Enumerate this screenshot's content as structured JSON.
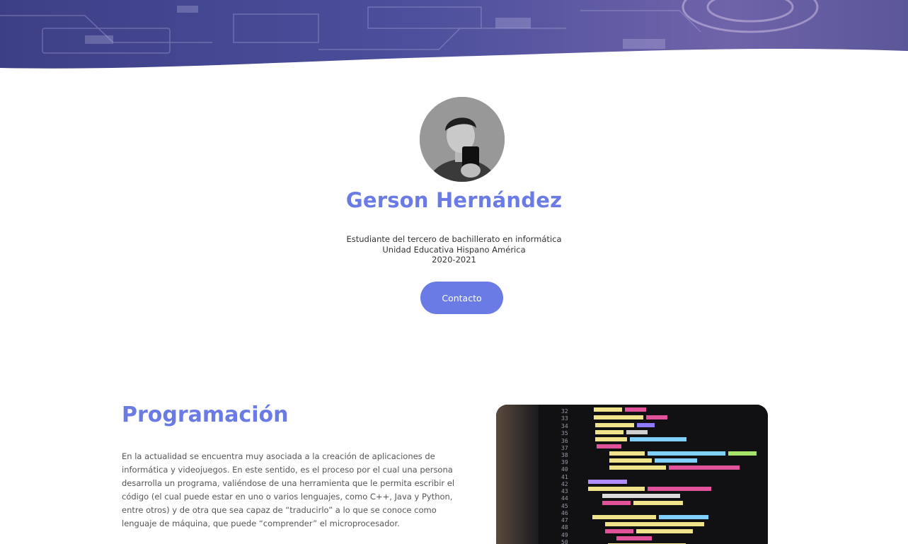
{
  "hero": {
    "image_icon": "circuit-board-image"
  },
  "profile": {
    "avatar_icon": "profile-photo",
    "name": "Gerson Hernández",
    "lines": [
      "Estudiante del tercero de bachillerato en informática",
      "Unidad Educativa Hispano América",
      "2020-2021"
    ],
    "contact_label": "Contacto"
  },
  "section": {
    "title": "Programación",
    "paragraph": "En la actualidad se encuentra muy asociada a la creación de aplicaciones de informática y videojuegos. En este sentido, es el proceso por el cual una persona desarrolla un programa, valiéndose de una herramienta que le permita escribir el código (el cual puede estar en uno o varios lenguajes, como C++, Java y Python, entre otros) y de otra que sea capaz de “traducirlo” a lo que se conoce como lenguaje de máquina, que puede “comprender” el microprocesador.",
    "image_icon": "code-screen-image"
  },
  "colors": {
    "accent": "#6a7be6",
    "text": "#555555",
    "hero_tint": "#4a4f9a"
  }
}
